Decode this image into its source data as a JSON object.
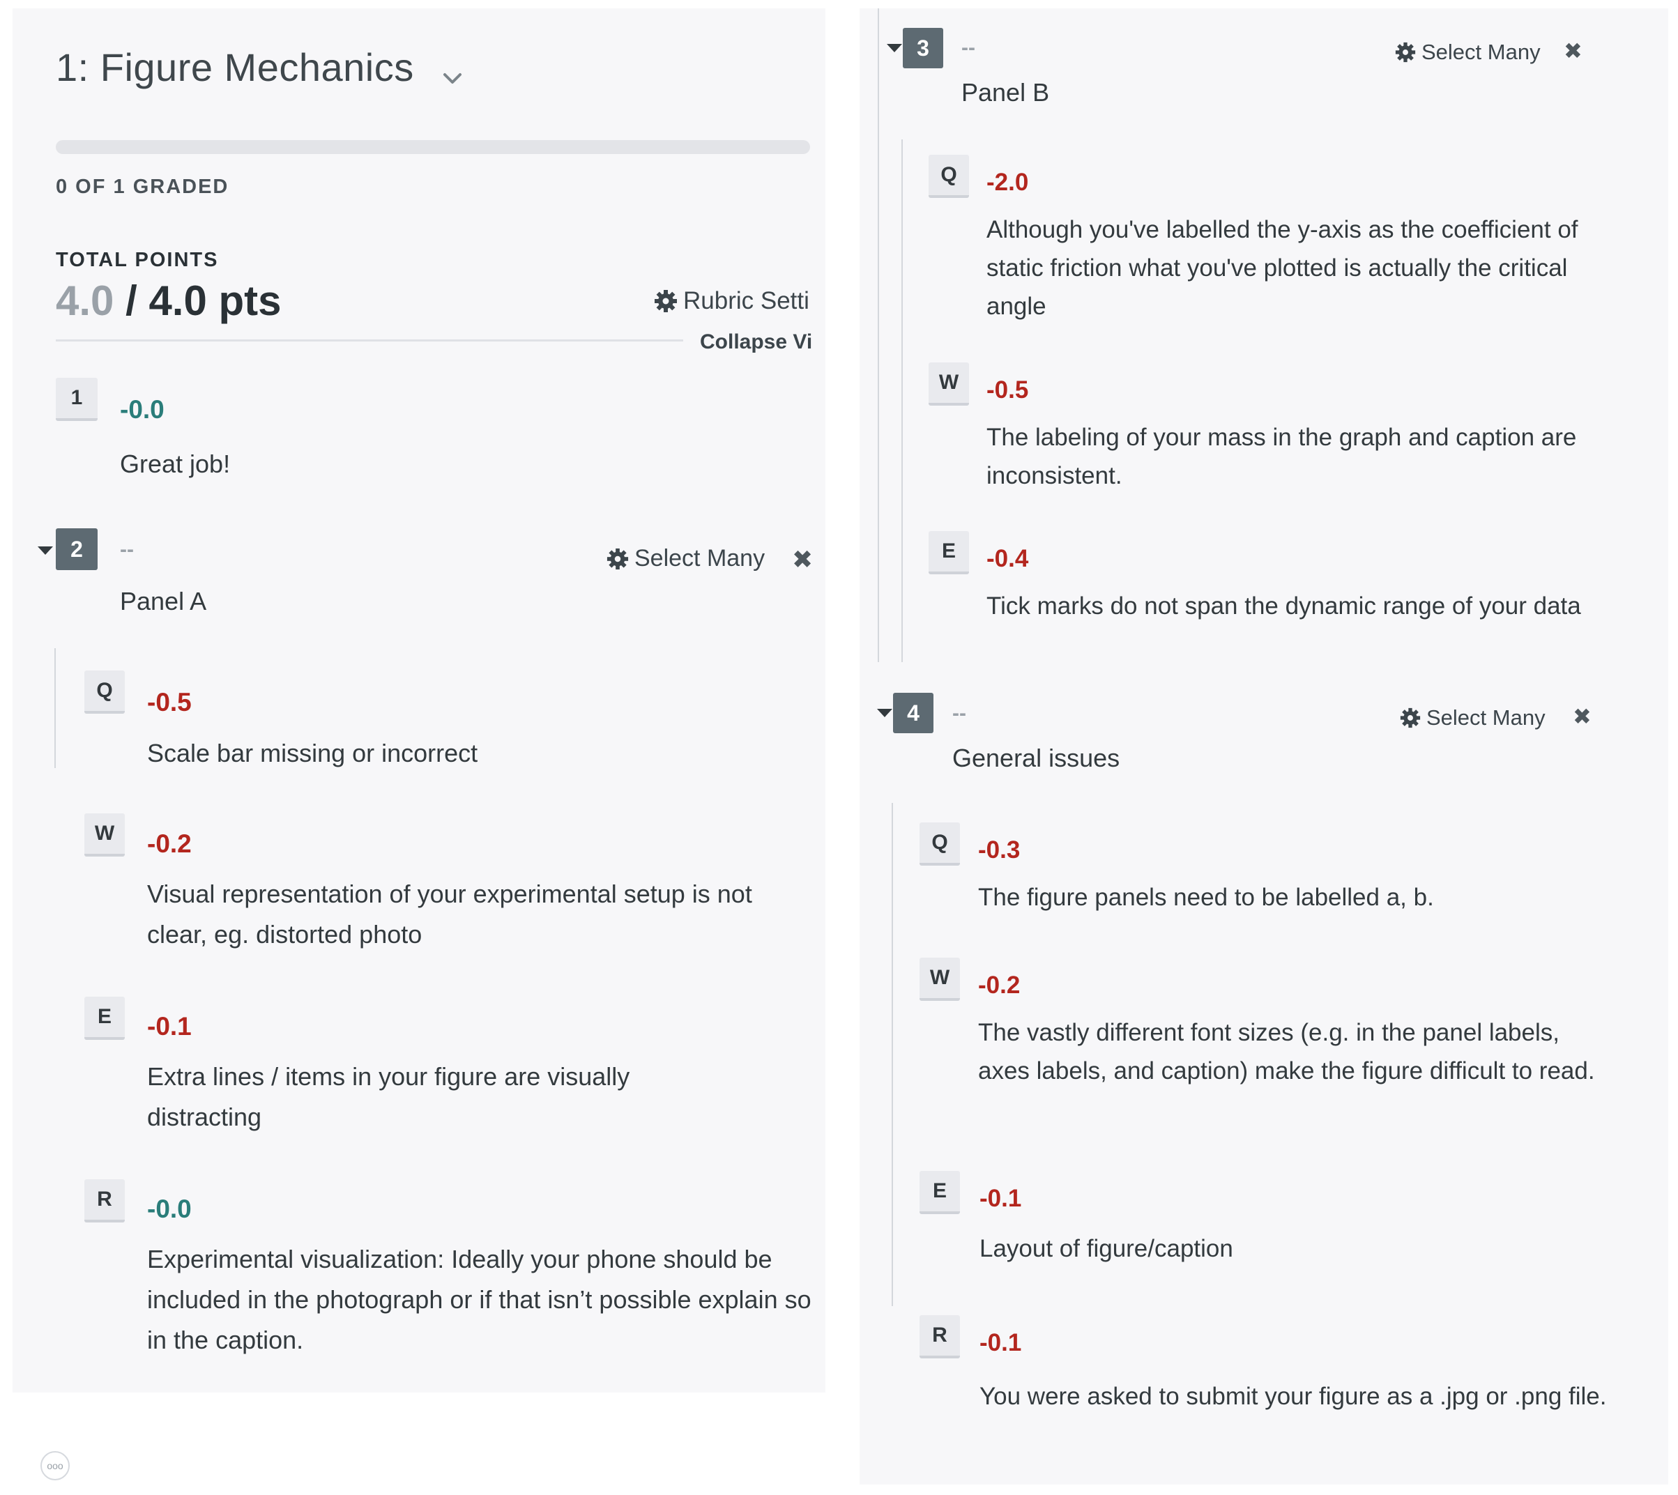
{
  "question": {
    "title": "1: Figure Mechanics",
    "graded_status": "0 OF 1 GRADED",
    "total_points_label": "TOTAL POINTS",
    "points_earned": "4.0",
    "points_separator": " / ",
    "points_total": "4.0 pts",
    "rubric_settings_label": "Rubric Setti",
    "collapse_label": "Collapse Vi",
    "progress": 0
  },
  "items": {
    "item1": {
      "number": "1",
      "points": "-0.0",
      "description": "Great job!"
    },
    "group2": {
      "number": "2",
      "points": "--",
      "label": "Panel A",
      "select_many": "Select Many",
      "close": "✖",
      "items": [
        {
          "key": "Q",
          "points": "-0.5",
          "description": "Scale bar missing or incorrect"
        },
        {
          "key": "W",
          "points": "-0.2",
          "description": "Visual representation of your experimental setup is not clear, eg. distorted photo"
        },
        {
          "key": "E",
          "points": "-0.1",
          "description": "Extra lines / items in your figure are visually distracting"
        },
        {
          "key": "R",
          "points": "-0.0",
          "description": "Experimental visualization: Ideally your phone should be included in the photograph or if that isn’t possible explain so in the caption."
        }
      ]
    },
    "group3": {
      "number": "3",
      "points": "--",
      "label": "Panel B",
      "select_many": "Select Many",
      "close": "✖",
      "items": [
        {
          "key": "Q",
          "points": "-2.0",
          "description": "Although you've labelled the y-axis as the coefficient of static friction what you've plotted is actually the critical angle"
        },
        {
          "key": "W",
          "points": "-0.5",
          "description": "The labeling of your mass in the graph and caption are inconsistent."
        },
        {
          "key": "E",
          "points": "-0.4",
          "description": "Tick marks do not span the dynamic range of your data"
        }
      ]
    },
    "group4": {
      "number": "4",
      "points": "--",
      "label": "General issues",
      "select_many": "Select Many",
      "close": "✖",
      "items": [
        {
          "key": "Q",
          "points": "-0.3",
          "description": "The figure panels need to be labelled a, b."
        },
        {
          "key": "W",
          "points": "-0.2",
          "description": "The vastly different font sizes (e.g. in the panel labels, axes labels, and caption) make the figure difficult to read."
        },
        {
          "key": "E",
          "points": "-0.1",
          "description": "Layout of figure/caption"
        },
        {
          "key": "R",
          "points": "-0.1",
          "description": "You were asked to submit your figure as a .jpg or .png file."
        }
      ]
    }
  },
  "footer": {
    "more_label": "ooo"
  },
  "colors": {
    "deduction": "#b3261e",
    "zero": "#2a7d7a",
    "key_bg": "#e9eaee",
    "group_key_bg": "#5d6a72",
    "panel_bg": "#f7f7f9"
  },
  "icons": {
    "gear": "gear-icon",
    "close": "close-icon",
    "chevron": "chevron-down-icon",
    "triangle": "caret-down-icon"
  }
}
